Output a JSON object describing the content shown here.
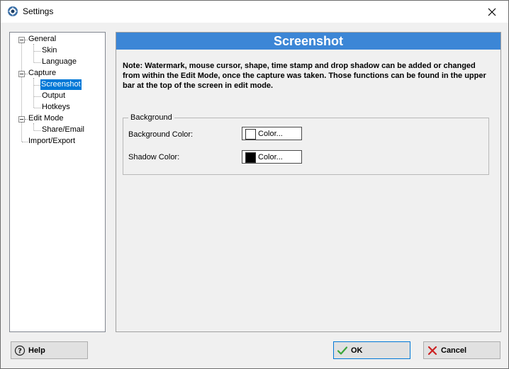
{
  "window": {
    "title": "Settings",
    "app_icon": "gear-lens-icon",
    "close_icon": "close-icon"
  },
  "tree": {
    "items": [
      {
        "label": "General",
        "level": 0,
        "expanded": true
      },
      {
        "label": "Skin",
        "level": 1
      },
      {
        "label": "Language",
        "level": 1
      },
      {
        "label": "Capture",
        "level": 0,
        "expanded": true
      },
      {
        "label": "Screenshot",
        "level": 1,
        "selected": true
      },
      {
        "label": "Output",
        "level": 1
      },
      {
        "label": "Hotkeys",
        "level": 1
      },
      {
        "label": "Edit Mode",
        "level": 0,
        "expanded": true
      },
      {
        "label": "Share/Email",
        "level": 1
      },
      {
        "label": "Import/Export",
        "level": 0
      }
    ]
  },
  "content": {
    "header": "Screenshot",
    "header_color": "#3c86d6",
    "note": "Note: Watermark, mouse cursor, shape, time stamp and drop shadow can be added or changed from within the Edit Mode, once the capture was taken. Those functions can be found in the upper bar at the top of the screen in edit mode.",
    "group": {
      "title": "Background",
      "fields": [
        {
          "label": "Background Color:",
          "button": "Color...",
          "swatch": "#ffffff"
        },
        {
          "label": "Shadow Color:",
          "button": "Color...",
          "swatch": "#000000"
        }
      ]
    }
  },
  "footer": {
    "help": "Help",
    "ok": "OK",
    "cancel": "Cancel",
    "ok_icon_color": "#3aa53a",
    "cancel_icon_color": "#cc2222"
  }
}
